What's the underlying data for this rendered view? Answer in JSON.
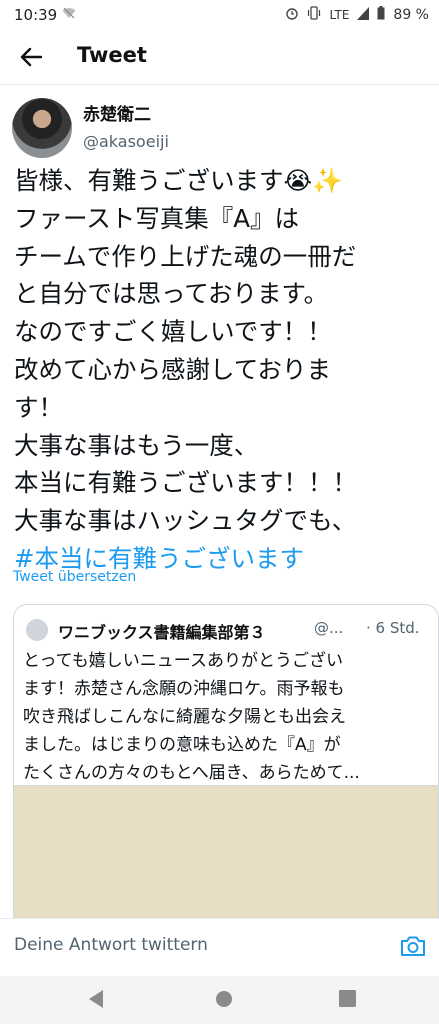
{
  "status_bar": {
    "time": "10:39",
    "network": "LTE",
    "battery": "89 %",
    "icons": [
      "wifi-off-icon",
      "alarm-icon",
      "vibrate-icon",
      "signal-icon",
      "battery-icon"
    ]
  },
  "header": {
    "back_icon": "back-arrow-icon",
    "title": "Tweet"
  },
  "tweet": {
    "author_name": "赤楚衛二",
    "author_handle": "@akasoeiji",
    "lines": [
      "皆様、有難うございます😭✨",
      "ファースト写真集『A』は",
      "チームで作り上げた魂の一冊だ",
      "と自分では思っております。",
      "なのですごく嬉しいです！！",
      "改めて心から感謝しておりま",
      "す！",
      "大事な事はもう一度、",
      "本当に有難うございます！！！",
      "大事な事はハッシュタグでも、"
    ],
    "hashtag": "#本当に有難うございます",
    "translate_link": "Tweet übersetzen"
  },
  "quoted_tweet": {
    "author_name": "ワニブックス書籍編集部第３",
    "author_handle": "@...",
    "time": "· 6 Std.",
    "lines": [
      "とっても嬉しいニュースありがとうござい",
      "ます！赤楚さん念願の沖縄ロケ。雨予報も",
      "吹き飛ばしこんなに綺麗な夕陽とも出会え",
      "ました。はじまりの意味も込めた『A』が",
      "たくさんの方々のもとへ届き、あらためて..."
    ]
  },
  "reply_bar": {
    "placeholder": "Deine Antwort twittern",
    "camera_icon": "camera-icon"
  },
  "nav_bar": {
    "icons": [
      "nav-back-icon",
      "nav-home-icon",
      "nav-recents-icon"
    ]
  },
  "colors": {
    "link": "#1d9bf0",
    "secondary_text": "#536471",
    "quote_image": "#e8dec3"
  }
}
